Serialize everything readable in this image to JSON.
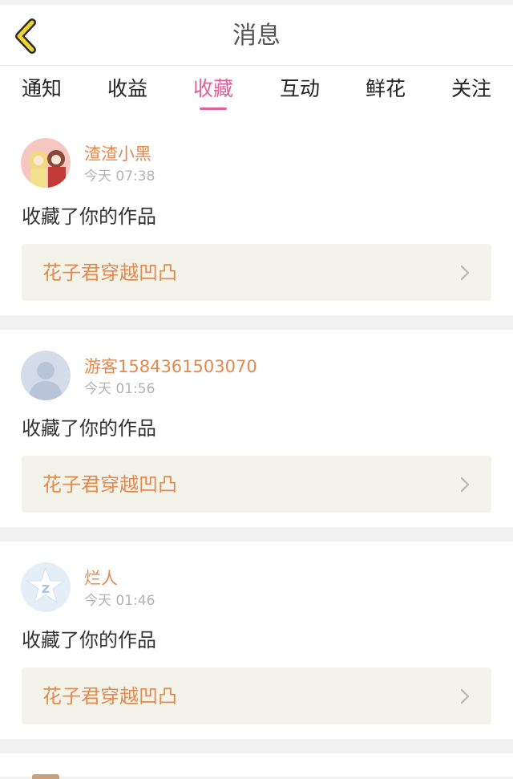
{
  "header": {
    "title": "消息"
  },
  "tabs": [
    {
      "label": "通知",
      "active": false
    },
    {
      "label": "收益",
      "active": false
    },
    {
      "label": "收藏",
      "active": true
    },
    {
      "label": "互动",
      "active": false
    },
    {
      "label": "鲜花",
      "active": false
    },
    {
      "label": "关注",
      "active": false
    }
  ],
  "colors": {
    "accent": "#e0609a",
    "username": "#e3894e",
    "back_arrow": "#f2d22e",
    "work_bg": "#f3f3ea"
  },
  "messages": [
    {
      "user": "渣渣小黑",
      "time": "今天 07:38",
      "action": "收藏了你的作品",
      "work": "花子君穿越凹凸",
      "avatar_icon": "anime-avatar-icon"
    },
    {
      "user": "游客1584361503070",
      "time": "今天 01:56",
      "action": "收藏了你的作品",
      "work": "花子君穿越凹凸",
      "avatar_icon": "default-user-avatar-icon"
    },
    {
      "user": "烂人",
      "time": "今天 01:46",
      "action": "收藏了你的作品",
      "work": "花子君穿越凹凸",
      "avatar_icon": "qzone-star-avatar-icon"
    }
  ]
}
